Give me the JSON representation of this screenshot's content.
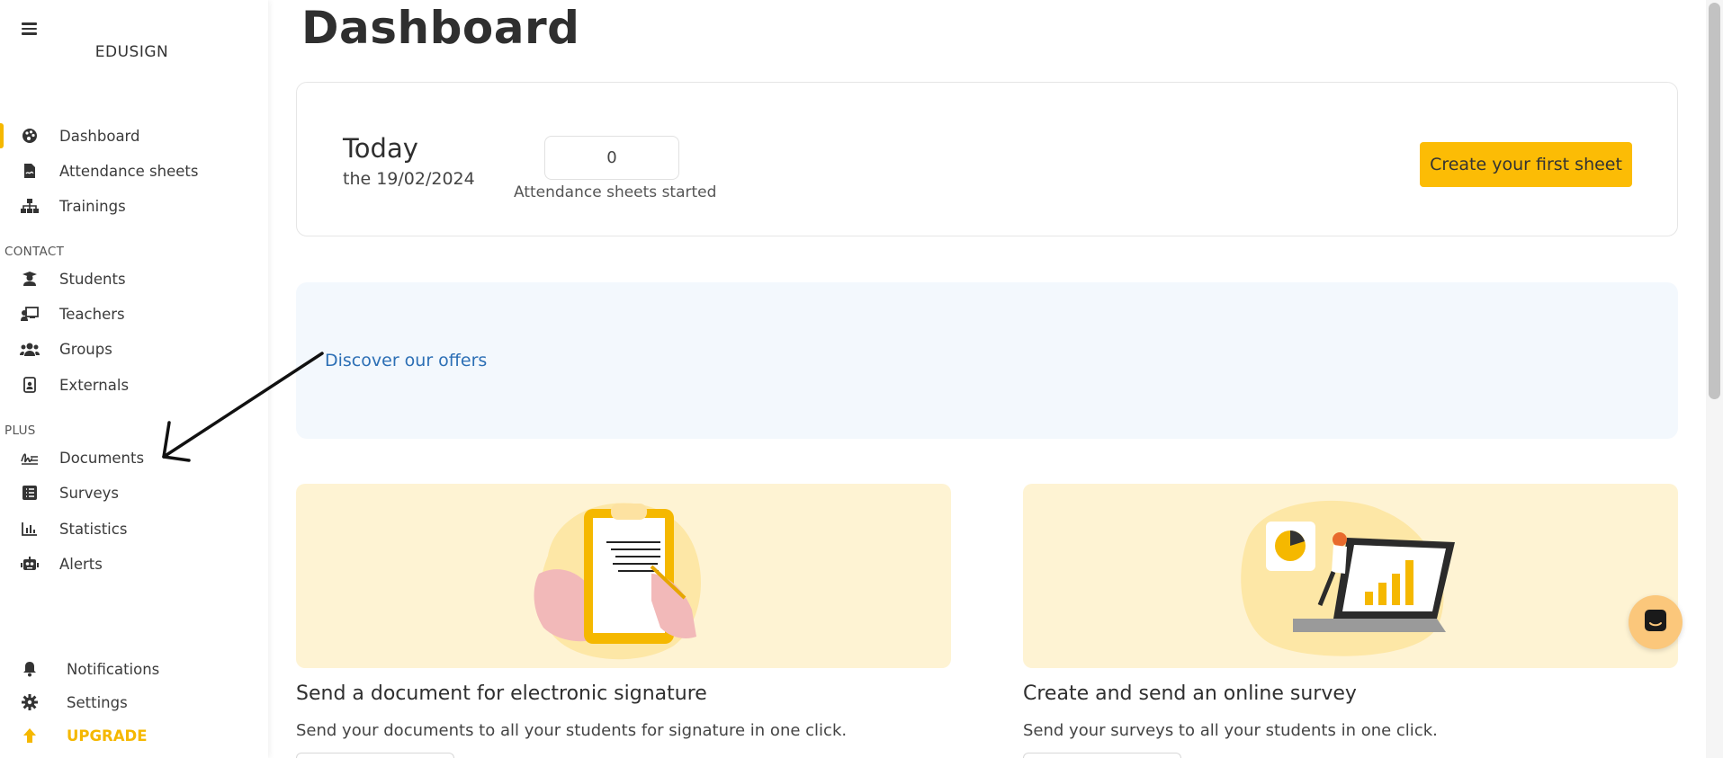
{
  "brand": "EDUSIGN",
  "colors": {
    "accent": "#fcbc05",
    "link": "#2c6fb5",
    "banner": "#f3f8fd",
    "card": "#fef3d3"
  },
  "sidebar": {
    "main_items": [
      {
        "label": "Dashboard",
        "icon": "palette-icon",
        "active": true
      },
      {
        "label": "Attendance sheets",
        "icon": "file-signature-icon"
      },
      {
        "label": "Trainings",
        "icon": "sitemap-icon"
      }
    ],
    "contact_title": "CONTACT",
    "contact_items": [
      {
        "label": "Students",
        "icon": "student-icon"
      },
      {
        "label": "Teachers",
        "icon": "teacher-icon"
      },
      {
        "label": "Groups",
        "icon": "users-icon"
      },
      {
        "label": "Externals",
        "icon": "id-badge-icon"
      }
    ],
    "plus_title": "PLUS",
    "plus_items": [
      {
        "label": "Documents",
        "icon": "signature-icon"
      },
      {
        "label": "Surveys",
        "icon": "list-icon"
      },
      {
        "label": "Statistics",
        "icon": "chart-bar-icon"
      },
      {
        "label": "Alerts",
        "icon": "robot-icon"
      }
    ],
    "bottom_items": [
      {
        "label": "Notifications",
        "icon": "bell-icon"
      },
      {
        "label": "Settings",
        "icon": "gear-icon"
      },
      {
        "label": "UPGRADE",
        "icon": "arrow-up-icon"
      }
    ]
  },
  "main": {
    "title": "Dashboard",
    "today": {
      "title": "Today",
      "date": "the 19/02/2024",
      "count": "0",
      "count_label": "Attendance sheets started",
      "create_button": "Create your first sheet"
    },
    "offers_link": "Discover our offers",
    "features": [
      {
        "title": "Send a document for electronic signature",
        "description": "Send your documents to all your students for signature in one click."
      },
      {
        "title": "Create and send an online survey",
        "description": "Send your surveys to all your students in one click."
      }
    ]
  }
}
